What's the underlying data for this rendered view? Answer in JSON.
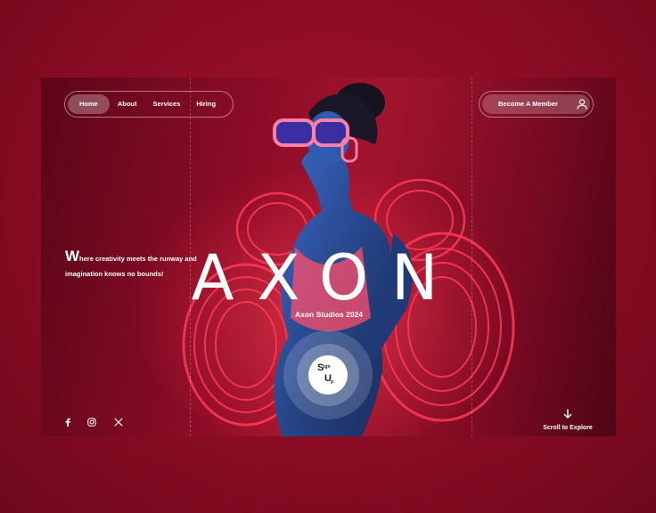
{
  "nav": {
    "items": [
      {
        "label": "Home",
        "active": true
      },
      {
        "label": "About",
        "active": false
      },
      {
        "label": "Services",
        "active": false
      },
      {
        "label": "Hiring",
        "active": false
      }
    ]
  },
  "header": {
    "member_button": "Become A Member",
    "member_icon": "user-icon"
  },
  "hero": {
    "tagline_initial": "W",
    "tagline_rest": "here creativity meets the runway and imagination knows no bounds!",
    "brand": "AXON",
    "subtitle": "Axon Studios 2024",
    "signup": {
      "s": "S",
      "ign": "ign",
      "u": "U",
      "p": "p"
    }
  },
  "social": {
    "icons": [
      "facebook-icon",
      "instagram-icon",
      "x-icon"
    ]
  },
  "footer": {
    "scroll_label": "Scroll to Explore",
    "scroll_icon": "arrow-down-icon"
  },
  "colors": {
    "page_background": "#8a0c24",
    "frame_background": "#8d0c27",
    "accent_red": "#ff2a47",
    "skin_blue": "#2a4a9c",
    "sunglasses_pink": "#ff7fa6"
  }
}
